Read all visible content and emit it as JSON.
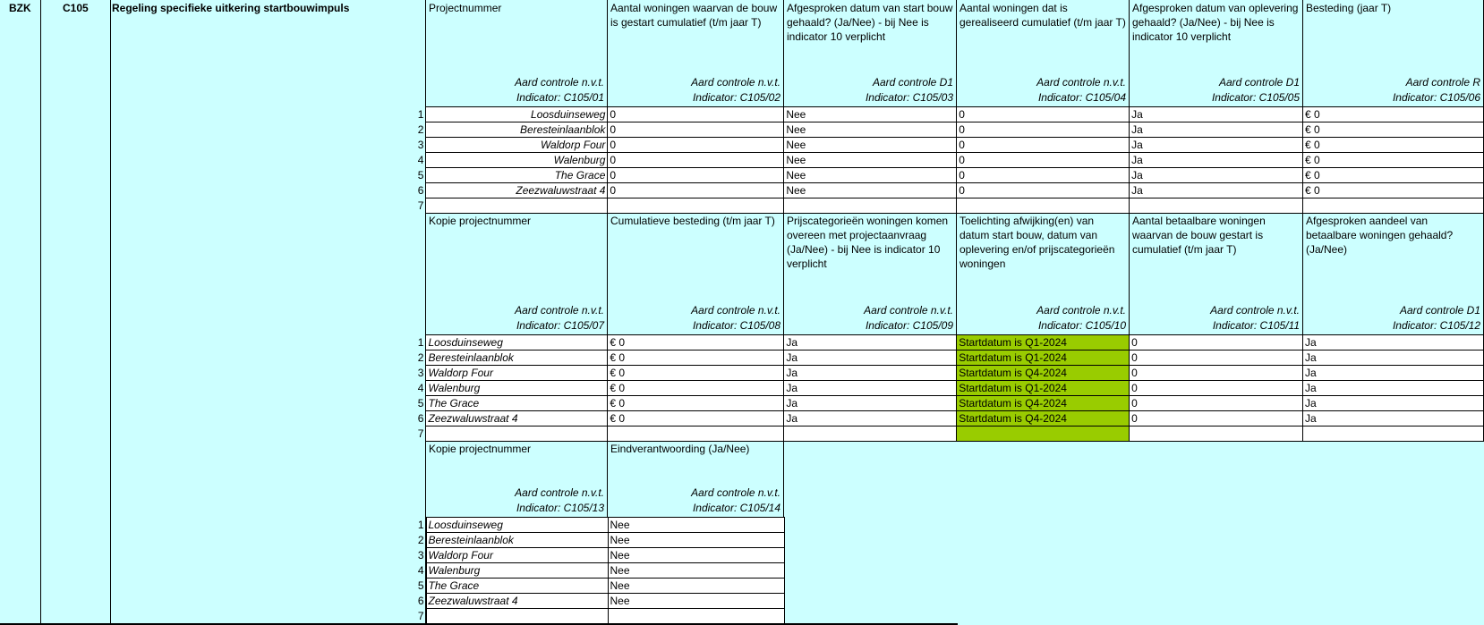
{
  "meta": {
    "ministry": "BZK",
    "code": "C105",
    "title": "Regeling specifieke uitkering startbouwimpuls"
  },
  "row_numbers": [
    "1",
    "2",
    "3",
    "4",
    "5",
    "6",
    "7"
  ],
  "section1": {
    "headers": [
      {
        "title": "Projectnummer",
        "control": "Aard controle n.v.t.",
        "indicator": "Indicator: C105/01"
      },
      {
        "title": "Aantal woningen waarvan de bouw is gestart cumulatief (t/m jaar T)",
        "control": "Aard controle n.v.t.",
        "indicator": "Indicator: C105/02"
      },
      {
        "title": "Afgesproken datum van start bouw gehaald? (Ja/Nee) - bij Nee is indicator 10 verplicht",
        "control": "Aard controle D1",
        "indicator": "Indicator: C105/03"
      },
      {
        "title": "Aantal woningen dat is gerealiseerd cumulatief (t/m jaar T)",
        "control": "Aard controle n.v.t.",
        "indicator": "Indicator: C105/04"
      },
      {
        "title": "Afgesproken datum van oplevering gehaald? (Ja/Nee) - bij Nee is indicator 10 verplicht",
        "control": "Aard controle D1",
        "indicator": "Indicator: C105/05"
      },
      {
        "title": "Besteding (jaar T)",
        "control": "Aard controle R",
        "indicator": "Indicator: C105/06"
      }
    ],
    "rows": [
      [
        "Loosduinseweg",
        "0",
        "Nee",
        "0",
        "Ja",
        "€ 0"
      ],
      [
        "Beresteinlaanblok",
        "0",
        "Nee",
        "0",
        "Ja",
        "€ 0"
      ],
      [
        "Waldorp Four",
        "0",
        "Nee",
        "0",
        "Ja",
        "€ 0"
      ],
      [
        "Walenburg",
        "0",
        "Nee",
        "0",
        "Ja",
        "€ 0"
      ],
      [
        "The Grace",
        "0",
        "Nee",
        "0",
        "Ja",
        "€ 0"
      ],
      [
        "Zeezwaluwstraat 4",
        "0",
        "Nee",
        "0",
        "Ja",
        "€ 0"
      ],
      [
        "",
        "",
        "",
        "",
        "",
        ""
      ]
    ]
  },
  "section2": {
    "headers": [
      {
        "title": "Kopie projectnummer",
        "control": "Aard controle n.v.t.",
        "indicator": "Indicator: C105/07"
      },
      {
        "title": "Cumulatieve besteding (t/m jaar T)",
        "control": "Aard controle n.v.t.",
        "indicator": "Indicator: C105/08"
      },
      {
        "title": "Prijscategorieën woningen komen overeen met projectaanvraag (Ja/Nee) - bij Nee is indicator 10 verplicht",
        "control": "Aard controle n.v.t.",
        "indicator": "Indicator: C105/09"
      },
      {
        "title": "Toelichting afwijking(en) van datum start bouw, datum van oplevering en/of prijscategorieën woningen",
        "control": "Aard controle n.v.t.",
        "indicator": "Indicator: C105/10"
      },
      {
        "title": "Aantal betaalbare woningen waarvan de bouw gestart is cumulatief (t/m jaar T)",
        "control": "Aard controle n.v.t.",
        "indicator": "Indicator: C105/11"
      },
      {
        "title": "Afgesproken aandeel van betaalbare woningen gehaald? (Ja/Nee)",
        "control": "Aard controle D1",
        "indicator": "Indicator: C105/12"
      }
    ],
    "rows": [
      [
        "Loosduinseweg",
        "€ 0",
        "Ja",
        "Startdatum is Q1-2024",
        "0",
        "Ja"
      ],
      [
        "Beresteinlaanblok",
        "€ 0",
        "Ja",
        "Startdatum is Q1-2024",
        "0",
        "Ja"
      ],
      [
        "Waldorp Four",
        "€ 0",
        "Ja",
        "Startdatum is Q4-2024",
        "0",
        "Ja"
      ],
      [
        "Walenburg",
        "€ 0",
        "Ja",
        "Startdatum is Q1-2024",
        "0",
        "Ja"
      ],
      [
        "The Grace",
        "€ 0",
        "Ja",
        "Startdatum is Q4-2024",
        "0",
        "Ja"
      ],
      [
        "Zeezwaluwstraat 4",
        "€ 0",
        "Ja",
        "Startdatum is Q4-2024",
        "0",
        "Ja"
      ],
      [
        "",
        "",
        "",
        "",
        "",
        ""
      ]
    ]
  },
  "section3": {
    "headers": [
      {
        "title": "Kopie projectnummer",
        "control": "Aard controle n.v.t.",
        "indicator": "Indicator: C105/13"
      },
      {
        "title": "Eindverantwoording (Ja/Nee)",
        "control": "Aard controle n.v.t.",
        "indicator": "Indicator: C105/14"
      }
    ],
    "rows": [
      [
        "Loosduinseweg",
        "Nee"
      ],
      [
        "Beresteinlaanblok",
        "Nee"
      ],
      [
        "Waldorp Four",
        "Nee"
      ],
      [
        "Walenburg",
        "Nee"
      ],
      [
        "The Grace",
        "Nee"
      ],
      [
        "Zeezwaluwstraat 4",
        "Nee"
      ],
      [
        "",
        ""
      ]
    ]
  },
  "colors": {
    "background": "#ccffff",
    "highlight": "#99cc00",
    "cell": "#ffffff"
  }
}
